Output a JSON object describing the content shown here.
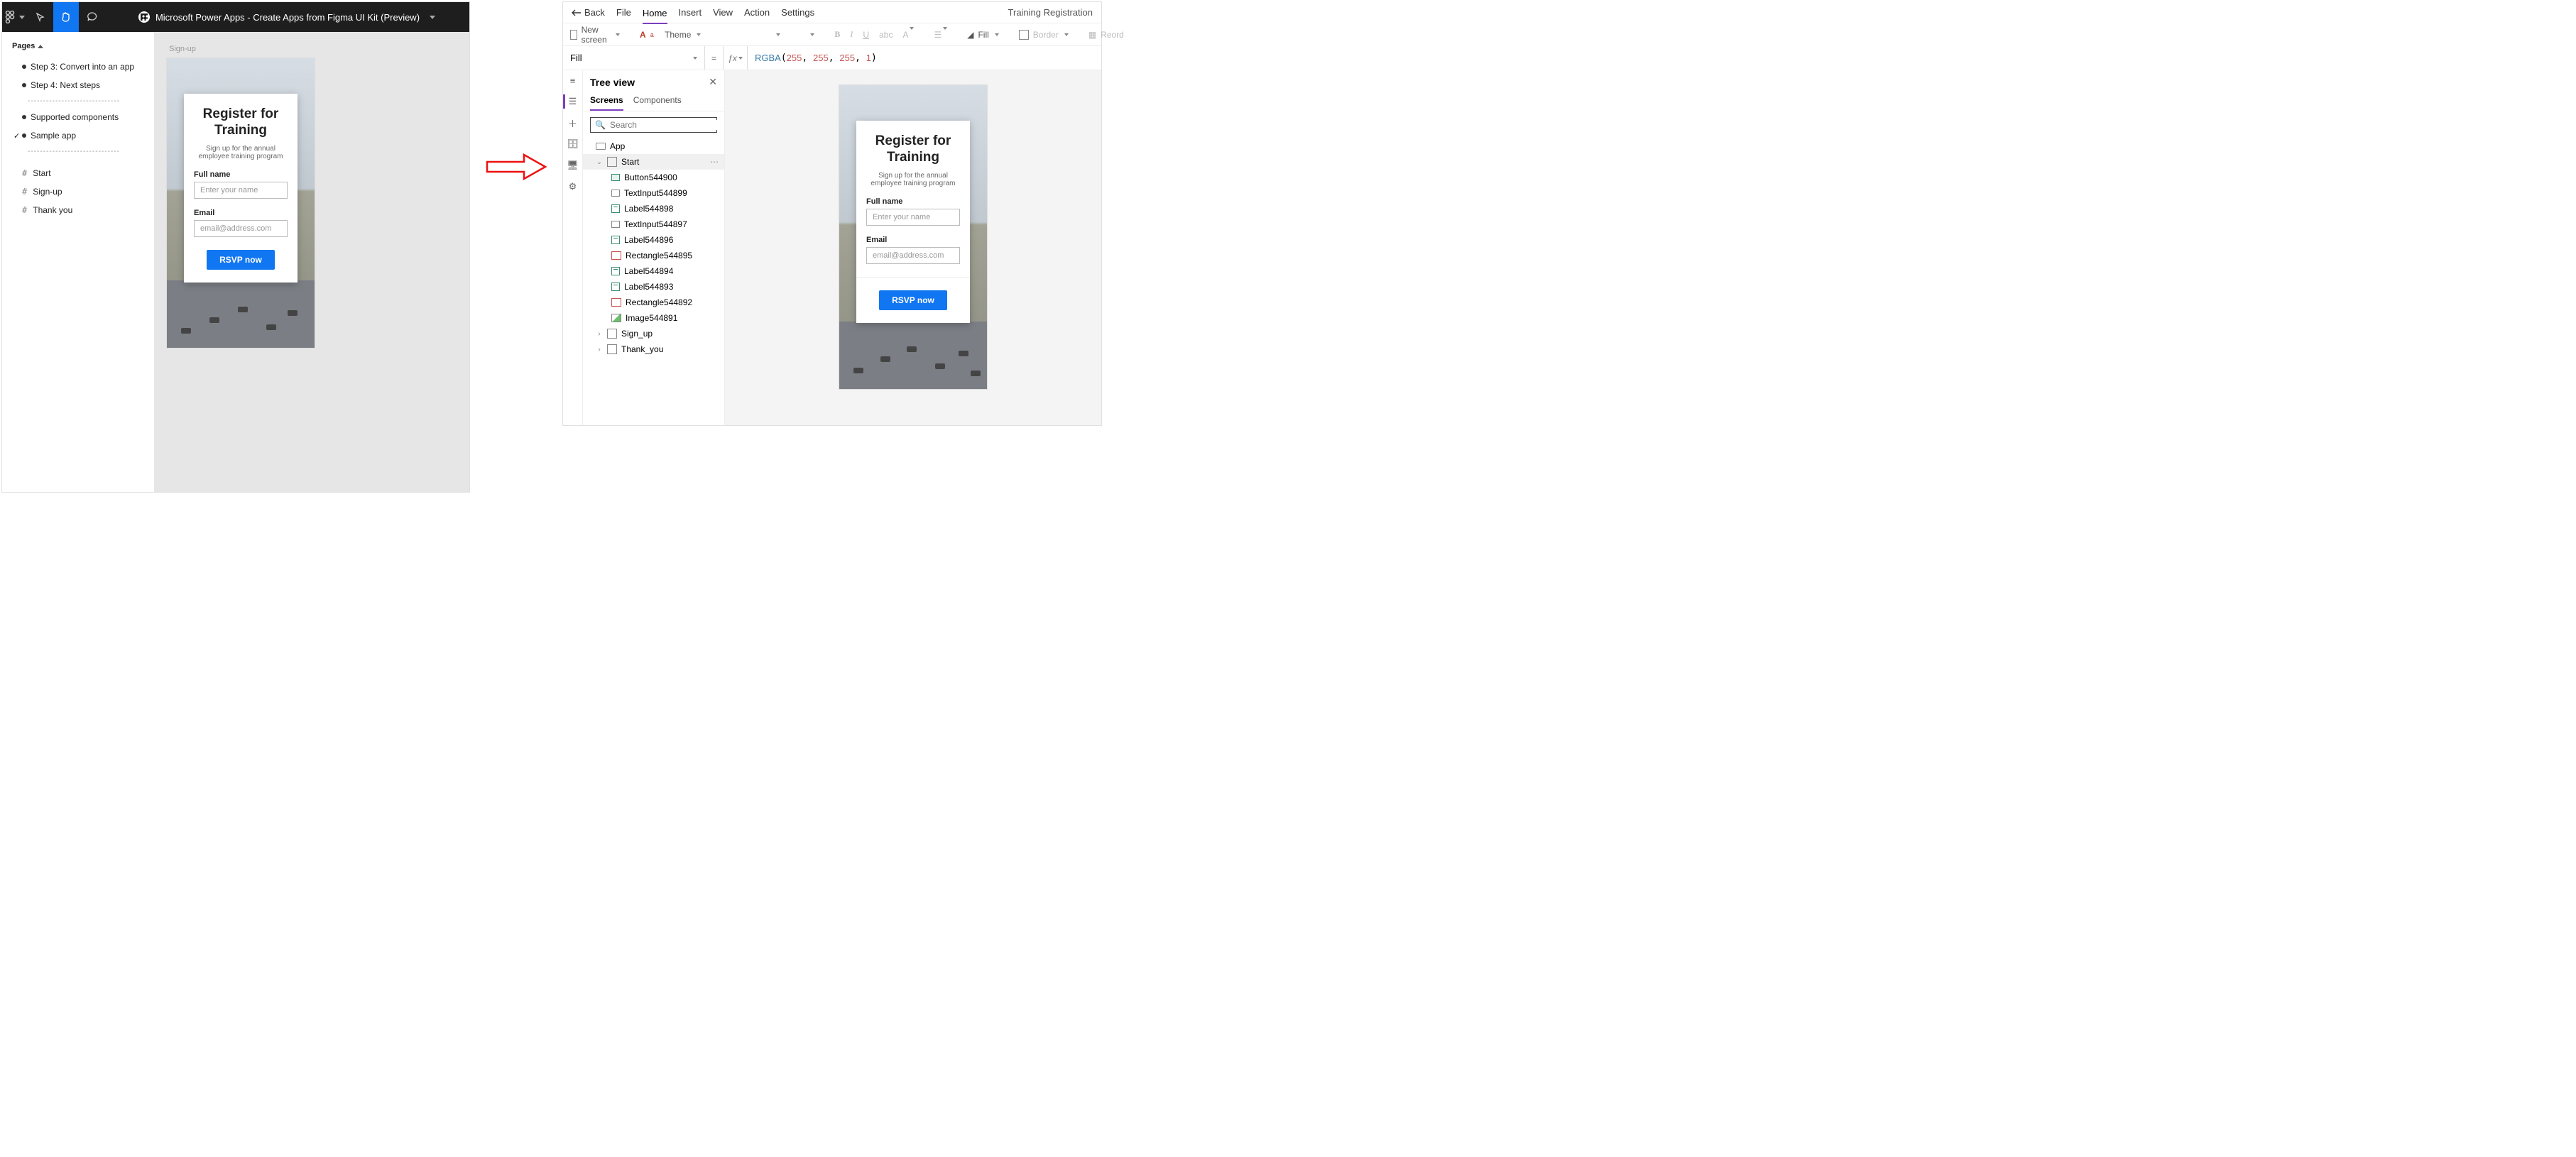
{
  "figma": {
    "title": "Microsoft Power Apps - Create Apps from Figma UI Kit (Preview)",
    "pages_label": "Pages",
    "pages": {
      "step3": "Step 3: Convert into an app",
      "step4": "Step 4: Next steps",
      "dash": "------------------------------",
      "supported": "Supported components",
      "sample": "Sample app"
    },
    "frames": {
      "start": "Start",
      "signup": "Sign-up",
      "thank": "Thank you"
    },
    "frame_label": "Sign-up"
  },
  "form": {
    "title_l1": "Register for",
    "title_l2": "Training",
    "subtitle": "Sign up for the annual employee training program",
    "fullname_label": "Full name",
    "fullname_ph": "Enter your name",
    "email_label": "Email",
    "email_ph": "email@address.com",
    "button": "RSVP now"
  },
  "pa": {
    "back": "Back",
    "menus": {
      "file": "File",
      "home": "Home",
      "insert": "Insert",
      "view": "View",
      "action": "Action",
      "settings": "Settings"
    },
    "app_name": "Training Registration",
    "ribbon": {
      "new_screen": "New screen",
      "theme": "Theme",
      "fill": "Fill",
      "border": "Border",
      "reord": "Reord"
    },
    "property": "Fill",
    "formula_fn": "RGBA",
    "formula_args": [
      "255",
      "255",
      "255",
      "1"
    ],
    "tree": {
      "title": "Tree view",
      "tabs": {
        "screens": "Screens",
        "components": "Components"
      },
      "search_ph": "Search",
      "app": "App",
      "screens": {
        "start": "Start",
        "signup": "Sign_up",
        "thank": "Thank_you"
      },
      "items": {
        "btn": "Button544900",
        "ti1": "TextInput544899",
        "lbl1": "Label544898",
        "ti2": "TextInput544897",
        "lbl2": "Label544896",
        "rect1": "Rectangle544895",
        "lbl3": "Label544894",
        "lbl4": "Label544893",
        "rect2": "Rectangle544892",
        "img": "Image544891"
      }
    }
  }
}
